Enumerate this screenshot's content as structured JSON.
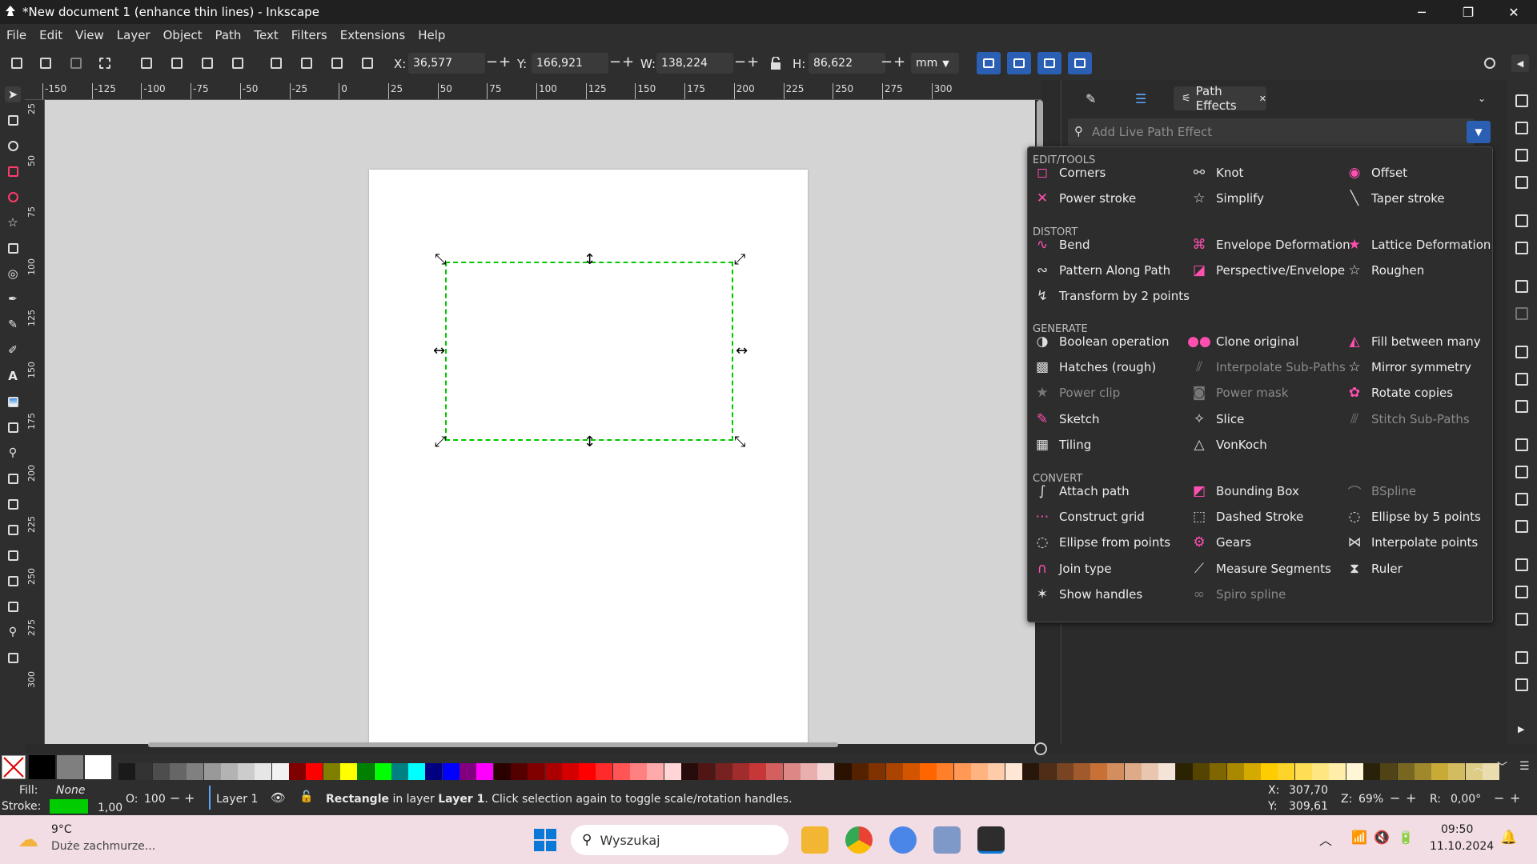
{
  "window": {
    "title": "*New document 1 (enhance thin lines) - Inkscape",
    "minimize": "─",
    "maximize": "❐",
    "close": "✕"
  },
  "menu": [
    "File",
    "Edit",
    "View",
    "Layer",
    "Object",
    "Path",
    "Text",
    "Filters",
    "Extensions",
    "Help"
  ],
  "toolbar": {
    "x_label": "X:",
    "x": "36,577",
    "y_label": "Y:",
    "y": "166,921",
    "w_label": "W:",
    "w": "138,224",
    "h_label": "H:",
    "h": "86,622",
    "unit": "mm",
    "minus": "−",
    "plus": "+"
  },
  "ruler": {
    "ticks": [
      "-150",
      "-125",
      "-100",
      "-75",
      "-50",
      "-25",
      "0",
      "25",
      "50",
      "75",
      "100",
      "125",
      "150",
      "175",
      "200",
      "225",
      "250",
      "275",
      "300"
    ],
    "vticks": [
      "25",
      "50",
      "75",
      "100",
      "125",
      "150",
      "175",
      "200",
      "225",
      "250",
      "275",
      "300"
    ]
  },
  "panel": {
    "tab_label": "Path Effects",
    "tab_close": "✕",
    "search_placeholder": "Add Live Path Effect",
    "categories": {
      "edit": "EDIT/TOOLS",
      "distort": "DISTORT",
      "generate": "GENERATE",
      "convert": "CONVERT"
    },
    "effects": {
      "edit": [
        {
          "label": "Corners",
          "icon": "corners-icon",
          "glyph": "◻",
          "color": "#ff4fb0",
          "disabled": false
        },
        {
          "label": "Knot",
          "icon": "knot-icon",
          "glyph": "⚯",
          "color": "#dddddd",
          "disabled": false
        },
        {
          "label": "Offset",
          "icon": "offset-icon",
          "glyph": "◉",
          "color": "#ff4fb0",
          "disabled": false
        },
        {
          "label": "Power stroke",
          "icon": "power-stroke-icon",
          "glyph": "✕",
          "color": "#ff4fb0",
          "disabled": false
        },
        {
          "label": "Simplify",
          "icon": "simplify-icon",
          "glyph": "☆",
          "color": "#dddddd",
          "disabled": false
        },
        {
          "label": "Taper stroke",
          "icon": "taper-stroke-icon",
          "glyph": "╲",
          "color": "#dddddd",
          "disabled": false
        }
      ],
      "distort": [
        {
          "label": "Bend",
          "icon": "bend-icon",
          "glyph": "∿",
          "color": "#ff4fb0",
          "disabled": false
        },
        {
          "label": "Envelope Deformation",
          "icon": "envelope-deformation-icon",
          "glyph": "⌘",
          "color": "#ff4fb0",
          "disabled": false
        },
        {
          "label": "Lattice Deformation",
          "icon": "lattice-deformation-icon",
          "glyph": "★",
          "color": "#ff4fb0",
          "disabled": false
        },
        {
          "label": "Pattern Along Path",
          "icon": "pattern-along-path-icon",
          "glyph": "∾",
          "color": "#dddddd",
          "disabled": false
        },
        {
          "label": "Perspective/Envelope",
          "icon": "perspective-envelope-icon",
          "glyph": "◪",
          "color": "#ff4fb0",
          "disabled": false
        },
        {
          "label": "Roughen",
          "icon": "roughen-icon",
          "glyph": "☆",
          "color": "#dddddd",
          "disabled": false
        },
        {
          "label": "Transform by 2 points",
          "icon": "transform-2-points-icon",
          "glyph": "↯",
          "color": "#dddddd",
          "disabled": false
        }
      ],
      "generate": [
        {
          "label": "Boolean operation",
          "icon": "boolean-operation-icon",
          "glyph": "◑",
          "color": "#dddddd",
          "disabled": false
        },
        {
          "label": "Clone original",
          "icon": "clone-original-icon",
          "glyph": "●●",
          "color": "#ff4fb0",
          "disabled": false
        },
        {
          "label": "Fill between many",
          "icon": "fill-between-many-icon",
          "glyph": "◭",
          "color": "#ff4fb0",
          "disabled": false
        },
        {
          "label": "Hatches (rough)",
          "icon": "hatches-icon",
          "glyph": "▩",
          "color": "#dddddd",
          "disabled": false
        },
        {
          "label": "Interpolate Sub-Paths",
          "icon": "interpolate-subpaths-icon",
          "glyph": "⫽",
          "color": "#777777",
          "disabled": true
        },
        {
          "label": "Mirror symmetry",
          "icon": "mirror-symmetry-icon",
          "glyph": "☆",
          "color": "#dddddd",
          "disabled": false
        },
        {
          "label": "Power clip",
          "icon": "power-clip-icon",
          "glyph": "★",
          "color": "#777777",
          "disabled": true
        },
        {
          "label": "Power mask",
          "icon": "power-mask-icon",
          "glyph": "◙",
          "color": "#777777",
          "disabled": true
        },
        {
          "label": "Rotate copies",
          "icon": "rotate-copies-icon",
          "glyph": "✿",
          "color": "#ff4fb0",
          "disabled": false
        },
        {
          "label": "Sketch",
          "icon": "sketch-icon",
          "glyph": "✎",
          "color": "#ff4fb0",
          "disabled": false
        },
        {
          "label": "Slice",
          "icon": "slice-icon",
          "glyph": "✧",
          "color": "#dddddd",
          "disabled": false
        },
        {
          "label": "Stitch Sub-Paths",
          "icon": "stitch-subpaths-icon",
          "glyph": "⫻",
          "color": "#777777",
          "disabled": true
        },
        {
          "label": "Tiling",
          "icon": "tiling-icon",
          "glyph": "▦",
          "color": "#dddddd",
          "disabled": false
        },
        {
          "label": "VonKoch",
          "icon": "vonkoch-icon",
          "glyph": "△",
          "color": "#dddddd",
          "disabled": false
        }
      ],
      "convert": [
        {
          "label": "Attach path",
          "icon": "attach-path-icon",
          "glyph": "∫",
          "color": "#dddddd",
          "disabled": false
        },
        {
          "label": "Bounding Box",
          "icon": "bounding-box-icon",
          "glyph": "◩",
          "color": "#ff4fb0",
          "disabled": false
        },
        {
          "label": "BSpline",
          "icon": "bspline-icon",
          "glyph": "⌒",
          "color": "#777777",
          "disabled": true
        },
        {
          "label": "Construct grid",
          "icon": "construct-grid-icon",
          "glyph": "⋯",
          "color": "#ff4fb0",
          "disabled": false
        },
        {
          "label": "Dashed Stroke",
          "icon": "dashed-stroke-icon",
          "glyph": "⬚",
          "color": "#dddddd",
          "disabled": false
        },
        {
          "label": "Ellipse by 5 points",
          "icon": "ellipse-5-points-icon",
          "glyph": "◌",
          "color": "#dddddd",
          "disabled": false
        },
        {
          "label": "Ellipse from points",
          "icon": "ellipse-from-points-icon",
          "glyph": "◌",
          "color": "#dddddd",
          "disabled": false
        },
        {
          "label": "Gears",
          "icon": "gears-icon",
          "glyph": "⚙",
          "color": "#ff4fb0",
          "disabled": false
        },
        {
          "label": "Interpolate points",
          "icon": "interpolate-points-icon",
          "glyph": "⋈",
          "color": "#dddddd",
          "disabled": false
        },
        {
          "label": "Join type",
          "icon": "join-type-icon",
          "glyph": "∩",
          "color": "#ff4fb0",
          "disabled": false
        },
        {
          "label": "Measure Segments",
          "icon": "measure-segments-icon",
          "glyph": "⟋",
          "color": "#dddddd",
          "disabled": false
        },
        {
          "label": "Ruler",
          "icon": "ruler-icon",
          "glyph": "⧗",
          "color": "#dddddd",
          "disabled": false
        },
        {
          "label": "Show handles",
          "icon": "show-handles-icon",
          "glyph": "✶",
          "color": "#dddddd",
          "disabled": false
        },
        {
          "label": "Spiro spline",
          "icon": "spiro-spline-icon",
          "glyph": "∞",
          "color": "#777777",
          "disabled": true
        }
      ]
    }
  },
  "palette": {
    "colors": [
      "#000000",
      "#7f7f7f",
      "#ffffff",
      "#1a1a1a",
      "#333333",
      "#4d4d4d",
      "#666666",
      "#808080",
      "#999999",
      "#b3b3b3",
      "#cccccc",
      "#e6e6e6",
      "#f2f2f2",
      "#800000",
      "#ff0000",
      "#808000",
      "#ffff00",
      "#008000",
      "#00ff00",
      "#008080",
      "#00ffff",
      "#000080",
      "#0000ff",
      "#800080",
      "#ff00ff",
      "#2b0000",
      "#550000",
      "#800000",
      "#aa0000",
      "#d40000",
      "#ff0000",
      "#ff2a2a",
      "#ff5555",
      "#ff8080",
      "#ffaaaa",
      "#ffd5d5",
      "#280b0b",
      "#501616",
      "#782121",
      "#a02c2c",
      "#c83737",
      "#d35f5f",
      "#de8787",
      "#e9afaf",
      "#f4d7d7",
      "#2b1100",
      "#552200",
      "#803300",
      "#aa4400",
      "#d45500",
      "#ff6600",
      "#ff7f2a",
      "#ff9955",
      "#ffb380",
      "#ffccaa",
      "#ffe6d5",
      "#28170b",
      "#502d16",
      "#784421",
      "#a05a2c",
      "#c87137",
      "#d38d5f",
      "#deaa87",
      "#e9c6af",
      "#f4e3d7",
      "#2b2200",
      "#554400",
      "#806600",
      "#aa8800",
      "#d4aa00",
      "#ffcc00",
      "#ffd42a",
      "#ffdd55",
      "#ffe680",
      "#ffeeaa",
      "#fff6d5",
      "#28220b",
      "#504416",
      "#786721",
      "#a0892c",
      "#c8ab37",
      "#d3bc5f",
      "#decd87",
      "#e9ddaf"
    ]
  },
  "status": {
    "fill_label": "Fill:",
    "fill_value": "None",
    "stroke_label": "Stroke:",
    "stroke_width": "1,00",
    "stroke_color": "#00cc00",
    "opacity_label": "O:",
    "opacity": "100",
    "layer": "Layer 1",
    "msg_bold": "Rectangle",
    "msg_mid": " in layer ",
    "msg_layer": "Layer 1",
    ". ": "",
    "msg_end": ". Click selection again to toggle scale/rotation handles.",
    "x_label": "X:",
    "x": "307,70",
    "y_label": "Y:",
    "y": "309,61",
    "zoom_label": "Z:",
    "zoom": "69%",
    "rot_label": "R:",
    "rotation": "0,00°"
  },
  "taskbar": {
    "temp": "9°C",
    "weather": "Duże zachmurze...",
    "search": "Wyszukaj",
    "time": "09:50",
    "date": "11.10.2024"
  }
}
